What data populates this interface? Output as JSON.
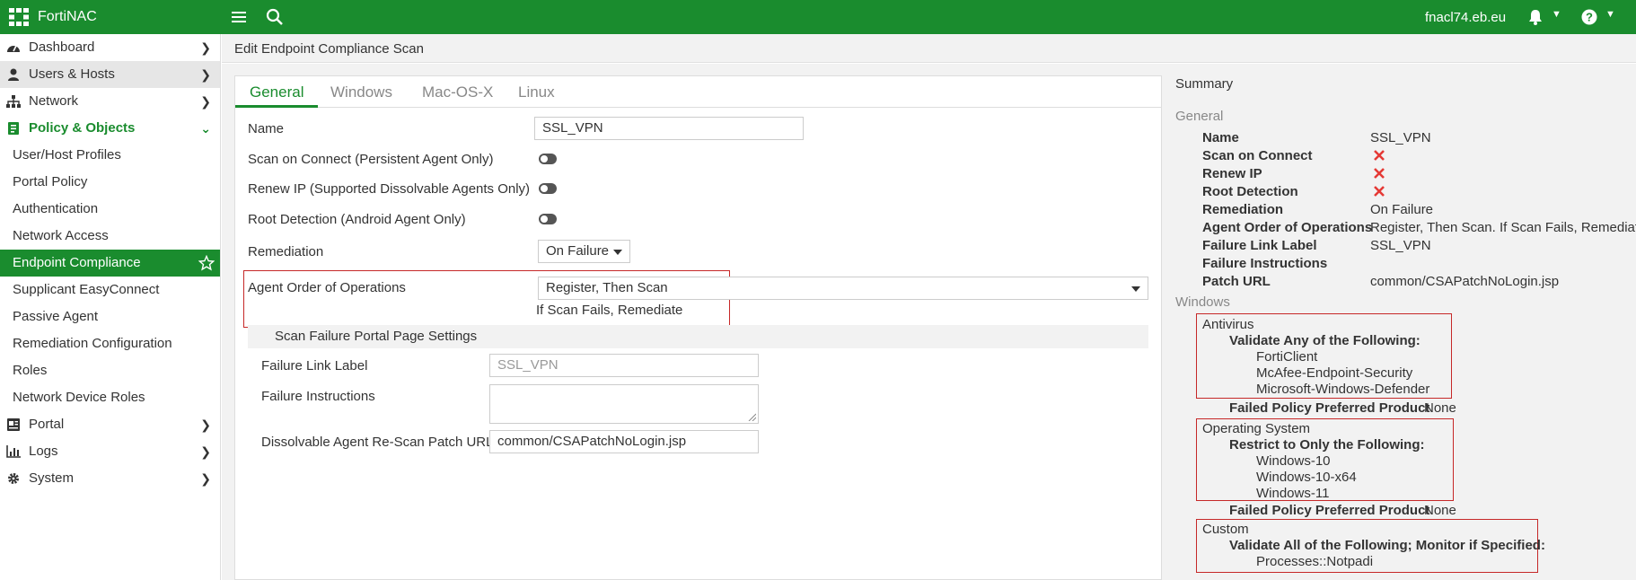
{
  "app": {
    "brand": "FortiNAC",
    "host": "fnacl74.eb.eu"
  },
  "icons": {
    "logo": "fortinet-logo-icon",
    "menu": "hamburger-icon",
    "search": "search-icon",
    "bell": "bell-icon",
    "help": "help-icon",
    "star": "star-icon"
  },
  "colors": {
    "brand": "#1a8c2e",
    "fail": "#e53935",
    "highlight_border": "#c62828"
  },
  "sidebar": {
    "dashboard": "Dashboard",
    "users_hosts": "Users & Hosts",
    "network": "Network",
    "policy_objects": "Policy & Objects",
    "sub": [
      "User/Host Profiles",
      "Portal Policy",
      "Authentication",
      "Network Access",
      "Endpoint Compliance",
      "Supplicant EasyConnect",
      "Passive Agent",
      "Remediation Configuration",
      "Roles",
      "Network Device Roles"
    ],
    "portal": "Portal",
    "logs": "Logs",
    "system": "System"
  },
  "breadcrumb": "Edit Endpoint Compliance Scan",
  "tabs": [
    "General",
    "Windows",
    "Mac-OS-X",
    "Linux"
  ],
  "form": {
    "name_label": "Name",
    "name_value": "SSL_VPN",
    "scan_on_connect_label": "Scan on Connect (Persistent Agent Only)",
    "renew_ip_label": "Renew IP (Supported Dissolvable Agents Only)",
    "root_detection_label": "Root Detection (Android Agent Only)",
    "remediation_label": "Remediation",
    "remediation_value": "On Failure",
    "agent_order_label": "Agent Order of Operations",
    "agent_order_value": "Register, Then Scan",
    "agent_order_note": "If Scan Fails, Remediate",
    "scan_failure_header": "Scan Failure Portal Page Settings",
    "failure_link_label": "Failure Link Label",
    "failure_link_value": "SSL_VPN",
    "failure_instructions_label": "Failure Instructions",
    "rescan_url_label": "Dissolvable Agent Re-Scan Patch URL",
    "rescan_url_value": "common/CSAPatchNoLogin.jsp"
  },
  "summary": {
    "title": "Summary",
    "general_header": "General",
    "name_key": "Name",
    "name_val": "SSL_VPN",
    "scan_key": "Scan on Connect",
    "renew_key": "Renew IP",
    "root_key": "Root Detection",
    "remediation_key": "Remediation",
    "remediation_val": "On Failure",
    "agent_key": "Agent Order of Operations",
    "agent_val": "Register, Then Scan. If Scan Fails, Remediate",
    "link_key": "Failure Link Label",
    "link_val": "SSL_VPN",
    "instr_key": "Failure Instructions",
    "patch_key": "Patch URL",
    "patch_val": "common/CSAPatchNoLogin.jsp",
    "windows_header": "Windows",
    "antivirus": "Antivirus",
    "validate_any": "Validate Any of the Following:",
    "av_items": [
      "FortiClient",
      "McAfee-Endpoint-Security",
      "Microsoft-Windows-Defender"
    ],
    "failed_pref_key": "Failed Policy Preferred Product",
    "failed_pref_val": "None",
    "os": "Operating System",
    "restrict": "Restrict to Only the Following:",
    "os_items": [
      "Windows-10",
      "Windows-10-x64",
      "Windows-11"
    ],
    "custom": "Custom",
    "validate_all": "Validate All of the Following; Monitor if Specified:",
    "custom_items": [
      "Processes::Notpadi"
    ]
  }
}
